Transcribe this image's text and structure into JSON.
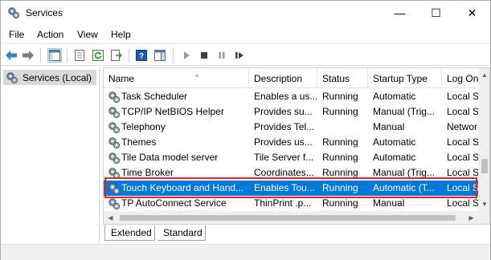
{
  "window": {
    "title": "Services",
    "minimize_glyph": "—",
    "maximize_glyph": "☐",
    "close_glyph": "✕"
  },
  "menu": [
    "File",
    "Action",
    "View",
    "Help"
  ],
  "toolbar": {
    "icons": [
      "back-icon",
      "forward-icon",
      "show-hide-tree-icon",
      "properties-icon",
      "refresh-icon",
      "export-list-icon",
      "help-icon",
      "show-action-pane-icon",
      "start-service-icon",
      "stop-service-icon",
      "pause-service-icon",
      "restart-service-icon"
    ]
  },
  "tree": {
    "root_label": "Services (Local)"
  },
  "columns": [
    "Name",
    "Description",
    "Status",
    "Startup Type",
    "Log On As"
  ],
  "rows": [
    {
      "name": "Task Scheduler",
      "description": "Enables a us...",
      "status": "Running",
      "startup": "Automatic",
      "logon": "Local S"
    },
    {
      "name": "TCP/IP NetBIOS Helper",
      "description": "Provides su...",
      "status": "Running",
      "startup": "Manual (Trig...",
      "logon": "Local S"
    },
    {
      "name": "Telephony",
      "description": "Provides Tel...",
      "status": "",
      "startup": "Manual",
      "logon": "Networ"
    },
    {
      "name": "Themes",
      "description": "Provides us...",
      "status": "Running",
      "startup": "Automatic",
      "logon": "Local S"
    },
    {
      "name": "Tile Data model server",
      "description": "Tile Server f...",
      "status": "Running",
      "startup": "Automatic",
      "logon": "Local S"
    },
    {
      "name": "Time Broker",
      "description": "Coordinates...",
      "status": "Running",
      "startup": "Manual (Trig...",
      "logon": "Local S"
    },
    {
      "name": "Touch Keyboard and Hand...",
      "description": "Enables Tou...",
      "status": "Running",
      "startup": "Automatic (T...",
      "logon": "Local S",
      "selected": true
    },
    {
      "name": "TP AutoConnect Service",
      "description": "ThinPrint .p...",
      "status": "Running",
      "startup": "Manual",
      "logon": "Local S"
    }
  ],
  "tabs": [
    "Extended",
    "Standard"
  ],
  "colors": {
    "selection": "#0078d7",
    "highlight_border": "#e8231a"
  }
}
